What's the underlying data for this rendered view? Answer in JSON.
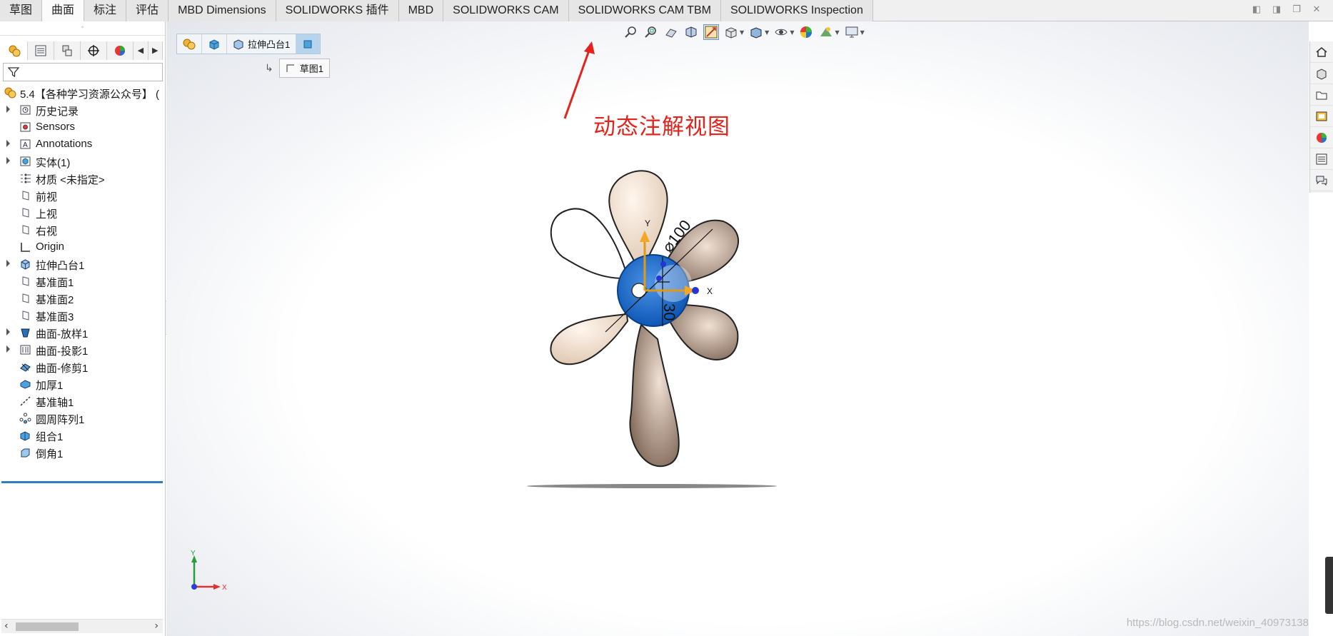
{
  "tabs": [
    "草图",
    "曲面",
    "标注",
    "评估",
    "MBD Dimensions",
    "SOLIDWORKS 插件",
    "MBD",
    "SOLIDWORKS CAM",
    "SOLIDWORKS CAM TBM",
    "SOLIDWORKS Inspection"
  ],
  "active_tab": "曲面",
  "window_controls": [
    "restore-left-icon",
    "restore-right-icon",
    "maximize-icon",
    "close-icon"
  ],
  "feature_manager": {
    "panel_tabs": [
      "featuremanager-icon",
      "propertymanager-icon",
      "configurationmanager-icon",
      "dimxpert-icon",
      "display-manager-icon"
    ],
    "filter_icon": "funnel-icon",
    "root": "5.4【各种学习资源公众号】 (",
    "items": [
      {
        "label": "历史记录",
        "icon": "history-icon",
        "expandable": true
      },
      {
        "label": "Sensors",
        "icon": "sensor-icon",
        "expandable": false
      },
      {
        "label": "Annotations",
        "icon": "annotation-icon",
        "expandable": true
      },
      {
        "label": "实体(1)",
        "icon": "solid-body-icon",
        "expandable": true
      },
      {
        "label": "材质 <未指定>",
        "icon": "material-icon",
        "expandable": false
      },
      {
        "label": "前视",
        "icon": "plane-icon",
        "expandable": false
      },
      {
        "label": "上视",
        "icon": "plane-icon",
        "expandable": false
      },
      {
        "label": "右视",
        "icon": "plane-icon",
        "expandable": false
      },
      {
        "label": "Origin",
        "icon": "origin-icon",
        "expandable": false
      },
      {
        "label": "拉伸凸台1",
        "icon": "boss-extrude-icon",
        "expandable": true
      },
      {
        "label": "基准面1",
        "icon": "plane-icon",
        "expandable": false
      },
      {
        "label": "基准面2",
        "icon": "plane-icon",
        "expandable": false
      },
      {
        "label": "基准面3",
        "icon": "plane-icon",
        "expandable": false
      },
      {
        "label": "曲面-放样1",
        "icon": "surface-loft-icon",
        "expandable": true
      },
      {
        "label": "曲面-投影1",
        "icon": "surface-project-icon",
        "expandable": true
      },
      {
        "label": "曲面-修剪1",
        "icon": "surface-trim-icon",
        "expandable": false
      },
      {
        "label": "加厚1",
        "icon": "thicken-icon",
        "expandable": false
      },
      {
        "label": "基准轴1",
        "icon": "axis-icon",
        "expandable": false
      },
      {
        "label": "圆周阵列1",
        "icon": "circular-pattern-icon",
        "expandable": false
      },
      {
        "label": "组合1",
        "icon": "combine-icon",
        "expandable": false
      },
      {
        "label": "倒角1",
        "icon": "chamfer-icon",
        "expandable": false
      }
    ]
  },
  "breadcrumb": {
    "items": [
      "",
      "",
      "拉伸凸台1",
      ""
    ],
    "sub_item": "草图1"
  },
  "annotation_callout": "动态注解视图",
  "model_dimensions": {
    "diameter": "⌀100",
    "depth": "30",
    "x_axis": "X",
    "y_axis": "Y"
  },
  "triad": {
    "x": "X",
    "y": "Y"
  },
  "watermark": "https://blog.csdn.net/weixin_40973138",
  "colors": {
    "callout": "#e4231d",
    "hub": "#1f6fd1",
    "selected": "#b7d4ef",
    "tree_end_bar": "#2f7ec4"
  }
}
